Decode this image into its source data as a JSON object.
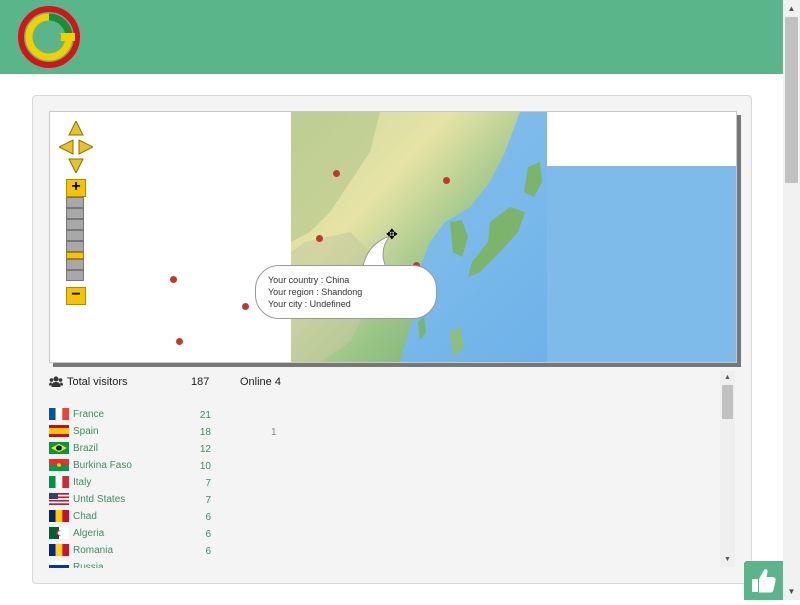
{
  "header": {
    "logo_icon": "brand-logo",
    "colors": {
      "background": "#5bb58b",
      "logo_red": "#d4141a",
      "logo_yellow": "#f1d000",
      "logo_green": "#1a8c3a"
    }
  },
  "map": {
    "controls": {
      "pan_icon": "pan-arrows-icon",
      "zoom_in_label": "+",
      "zoom_out_label": "−",
      "zoom_level_index": 5,
      "zoom_levels": 8
    },
    "tooltip": {
      "country": "Your country : China",
      "region": "Your region : Shandong",
      "city": "Your city : Undefined"
    }
  },
  "stats": {
    "users_icon": "users-icon",
    "total_label": "Total visitors",
    "total_value": "187",
    "online_label": "Online 4",
    "rows": [
      {
        "country": "France",
        "count": "21",
        "online": "",
        "flag": "france"
      },
      {
        "country": "Spain",
        "count": "18",
        "online": "1",
        "flag": "spain"
      },
      {
        "country": "Brazil",
        "count": "12",
        "online": "",
        "flag": "brazil"
      },
      {
        "country": "Burkina Faso",
        "count": "10",
        "online": "",
        "flag": "burkina-faso"
      },
      {
        "country": "Italy",
        "count": "7",
        "online": "",
        "flag": "italy"
      },
      {
        "country": "Untd States",
        "count": "7",
        "online": "",
        "flag": "united-states"
      },
      {
        "country": "Chad",
        "count": "6",
        "online": "",
        "flag": "chad"
      },
      {
        "country": "Algeria",
        "count": "6",
        "online": "",
        "flag": "algeria"
      },
      {
        "country": "Romania",
        "count": "6",
        "online": "",
        "flag": "romania"
      },
      {
        "country": "Russia",
        "count": "",
        "online": "",
        "flag": "russia"
      }
    ]
  },
  "like_button": {
    "icon": "thumbs-up-icon"
  }
}
